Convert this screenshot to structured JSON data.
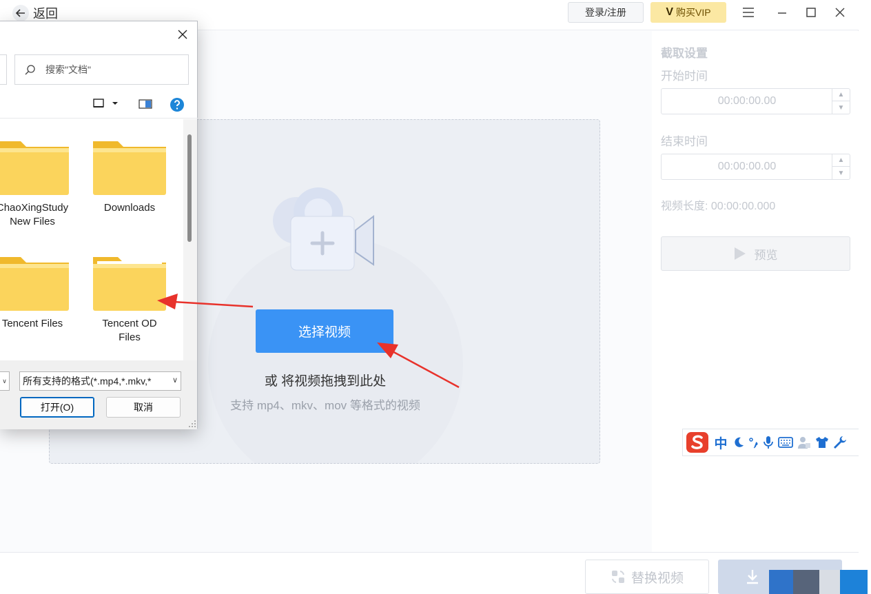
{
  "header": {
    "back_label": "返回",
    "login_label": "登录/注册",
    "vip_label": "购买VIP",
    "vip_logo": "V"
  },
  "settings": {
    "title": "截取设置",
    "start_label": "开始时间",
    "start_value": "00:00:00.00",
    "end_label": "结束时间",
    "end_value": "00:00:00.00",
    "duration_label": "视频长度: 00:00:00.000",
    "preview_label": "预览"
  },
  "dropzone": {
    "select_label": "选择视频",
    "or_text": "或 将视频拖拽到此处",
    "hint_text": "支持 mp4、mkv、mov 等格式的视频"
  },
  "bottom": {
    "replace_label": "替换视频"
  },
  "ime": {
    "items": [
      "S",
      "中",
      "moon-icon",
      "punctuation-icon",
      "mic-icon",
      "keyboard-icon",
      "user-icon",
      "shirt-icon",
      "wrench-icon"
    ],
    "lang_label": "中"
  },
  "dialog": {
    "search_placeholder": "搜索\"文档\"",
    "folders": [
      {
        "name": "ChaoXingStudy New Files"
      },
      {
        "name": "Downloads"
      },
      {
        "name": "Tencent Files"
      },
      {
        "name": "Tencent OD Files"
      }
    ],
    "folder_labels": {
      "f0_line1": "ChaoXingStudy",
      "f0_line2": "New Files",
      "f1_line1": "Downloads",
      "f2_line1": "Tencent Files",
      "f3_line1": "Tencent OD",
      "f3_line2": "Files"
    },
    "filetype_value": "所有支持的格式(*.mp4,*.mkv,*",
    "open_label": "打开(O)",
    "cancel_label": "取消"
  },
  "colors": {
    "accent": "#3a93f5",
    "vip": "#fbe8a3",
    "folder": "#f7c948",
    "annotation_arrow": "#e8322b"
  }
}
